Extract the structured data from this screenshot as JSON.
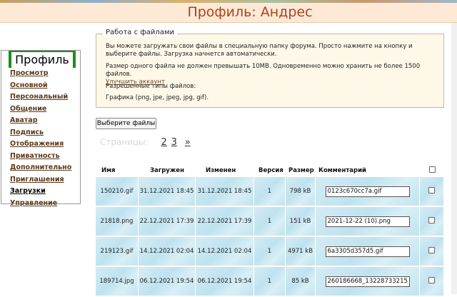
{
  "page": {
    "title": "Профиль: Андрес"
  },
  "sidebar": {
    "title": "Профиль",
    "items": [
      {
        "label": "Просмотр"
      },
      {
        "label": "Основной"
      },
      {
        "label": "Персональный"
      },
      {
        "label": "Общение"
      },
      {
        "label": "Аватар"
      },
      {
        "label": "Подпись"
      },
      {
        "label": "Отображения"
      },
      {
        "label": "Приватность"
      },
      {
        "label": "Дополнительно"
      },
      {
        "label": "Приглашения"
      },
      {
        "label": "Загрузки"
      },
      {
        "label": "Управление"
      }
    ]
  },
  "files_panel": {
    "legend": "Работа с файлами",
    "intro": "Вы можете загружать свои файлы в специальную папку форума. Просто нажмите на кнопку и выберите файлы. Загрузка начнется автоматически.",
    "limits": "Размер одного файла не должен превышать 10MB. Одновременно можно хранить не более 1500 файлов.",
    "upgrade_link": "Улучшить аккаунт",
    "allowed_label": "Разрешенные типы файлов:",
    "allowed_types": "Графика (png, jpe, jpeg, jpg, gif)."
  },
  "choose_button": "Выберите файлы",
  "pager": {
    "label": "Страницы:",
    "page2": "2",
    "page3": "3",
    "next": "»"
  },
  "table": {
    "headers": {
      "name": "Имя",
      "uploaded": "Загружен",
      "modified": "Изменен",
      "version": "Версия",
      "size": "Размер",
      "comment": "Комментарий"
    },
    "rows": [
      {
        "name": "150210.gif",
        "uploaded": "31.12.2021 18:45",
        "modified": "31.12.2021 18:45",
        "version": "1",
        "size": "798 kB",
        "comment": "0123c670cc7a.gif"
      },
      {
        "name": "21818.png",
        "uploaded": "22.12.2021 17:39",
        "modified": "22.12.2021 17:39",
        "version": "1",
        "size": "151 kB",
        "comment": "2021-12-22 (10).png"
      },
      {
        "name": "219123.gif",
        "uploaded": "14.12.2021 02:04",
        "modified": "14.12.2021 02:04",
        "version": "1",
        "size": "4971 kB",
        "comment": "6a3305d357d5.gif"
      },
      {
        "name": "189714.jpg",
        "uploaded": "06.12.2021 19:54",
        "modified": "06.12.2021 19:54",
        "version": "1",
        "size": "85 kB",
        "comment": "260186668_132287332150"
      }
    ]
  }
}
